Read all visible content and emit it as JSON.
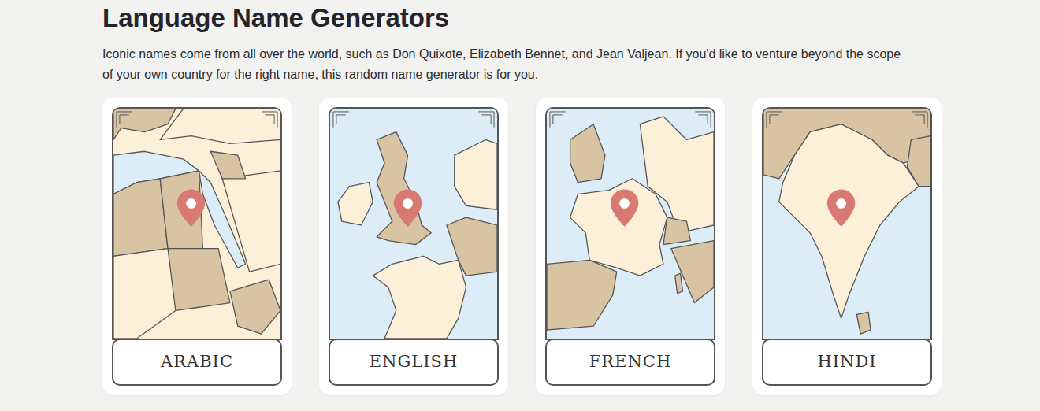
{
  "page": {
    "title": "Language Name Generators",
    "intro": "Iconic names come from all over the world, such as Don Quixote, Elizabeth Bennet, and Jean Valjean. If you'd like to venture beyond the scope of your own country for the right name, this random name generator is for you."
  },
  "cards": [
    {
      "label": "ARABIC"
    },
    {
      "label": "ENGLISH"
    },
    {
      "label": "FRENCH"
    },
    {
      "label": "HINDI"
    }
  ]
}
